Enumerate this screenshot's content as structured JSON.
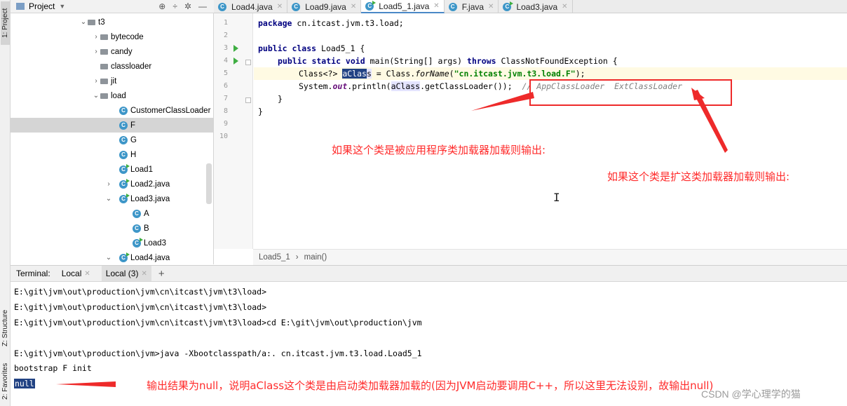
{
  "side_strip": {
    "project_tab": "1: Project",
    "structure_tab": "Z: Structure",
    "favorites_tab": "2: Favorites"
  },
  "project_panel": {
    "title": "Project",
    "tree": [
      {
        "label": "t3",
        "kind": "folder",
        "expanded": true
      },
      {
        "label": "bytecode",
        "kind": "folder",
        "expanded": false
      },
      {
        "label": "candy",
        "kind": "folder",
        "expanded": false
      },
      {
        "label": "classloader",
        "kind": "folder",
        "expanded": null
      },
      {
        "label": "jit",
        "kind": "folder",
        "expanded": false
      },
      {
        "label": "load",
        "kind": "folder",
        "expanded": true
      },
      {
        "label": "CustomerClassLoader",
        "kind": "class"
      },
      {
        "label": "F",
        "kind": "class",
        "selected": true
      },
      {
        "label": "G",
        "kind": "class"
      },
      {
        "label": "H",
        "kind": "class"
      },
      {
        "label": "Load1",
        "kind": "class-run"
      },
      {
        "label": "Load2.java",
        "kind": "class-run",
        "expanded": false
      },
      {
        "label": "Load3.java",
        "kind": "class-run",
        "expanded": true
      },
      {
        "label": "A",
        "kind": "class"
      },
      {
        "label": "B",
        "kind": "class"
      },
      {
        "label": "Load3",
        "kind": "class-run"
      },
      {
        "label": "Load4.java",
        "kind": "class-run",
        "expanded": true
      }
    ]
  },
  "editor_tabs": [
    {
      "label": "Load4.java",
      "active": false
    },
    {
      "label": "Load9.java",
      "active": false
    },
    {
      "label": "Load5_1.java",
      "active": true
    },
    {
      "label": "F.java",
      "active": false
    },
    {
      "label": "Load3.java",
      "active": false
    }
  ],
  "code": {
    "line_numbers": [
      "1",
      "2",
      "3",
      "4",
      "5",
      "6",
      "7",
      "8",
      "9",
      "10"
    ],
    "l1_kw": "package",
    "l1_rest": " cn.itcast.jvm.t3.load;",
    "l3_kw": "public class",
    "l3_rest": " Load5_1 {",
    "l4_kw1": "public static void",
    "l4_mid": " main(String[] args) ",
    "l4_kw2": "throws",
    "l4_rest": " ClassNotFoundException {",
    "l5_a": "Class<?> ",
    "l5_sel": "aClas",
    "l5_b": "s",
    "l5_c": " = Class.",
    "l5_method": "forName",
    "l5_d": "(",
    "l5_str": "\"cn.itcast.jvm.t3.load.F\"",
    "l5_e": ");",
    "l6_a": "System.",
    "l6_out": "out",
    "l6_b": ".println(",
    "l6_var": "aClass",
    "l6_c": ".getClassLoader());",
    "l6_cmt": "  // AppClassLoader  ExtClassLoader",
    "l7": "}",
    "l8": "}"
  },
  "breadcrumb": {
    "class": "Load5_1",
    "sep": "›",
    "method": "main()"
  },
  "terminal": {
    "label": "Terminal:",
    "tabs": [
      {
        "label": "Local",
        "active": false
      },
      {
        "label": "Local (3)",
        "active": true
      }
    ],
    "add": "+",
    "lines": [
      "E:\\git\\jvm\\out\\production\\jvm\\cn\\itcast\\jvm\\t3\\load>",
      "E:\\git\\jvm\\out\\production\\jvm\\cn\\itcast\\jvm\\t3\\load>",
      "E:\\git\\jvm\\out\\production\\jvm\\cn\\itcast\\jvm\\t3\\load>cd E:\\git\\jvm\\out\\production\\jvm",
      "E:\\git\\jvm\\out\\production\\jvm>java -Xbootclasspath/a:. cn.itcast.jvm.t3.load.Load5_1",
      "bootstrap F init"
    ],
    "null_line": "null"
  },
  "annotations": {
    "app_loader": "如果这个类是被应用程序类加载器加载则输出:",
    "ext_loader": "如果这个类是扩这类加载器加载则输出:",
    "bootstrap": "输出结果为null，说明aClass这个类是由启动类加载器加载的(因为JVM启动要调用C++，所以这里无法设别，故输出null)",
    "watermark": "CSDN @学心理学的猫"
  },
  "colors": {
    "annotation_red": "#ff2b2b",
    "selection_blue": "#214283",
    "keyword": "#000080",
    "string": "#008000"
  }
}
